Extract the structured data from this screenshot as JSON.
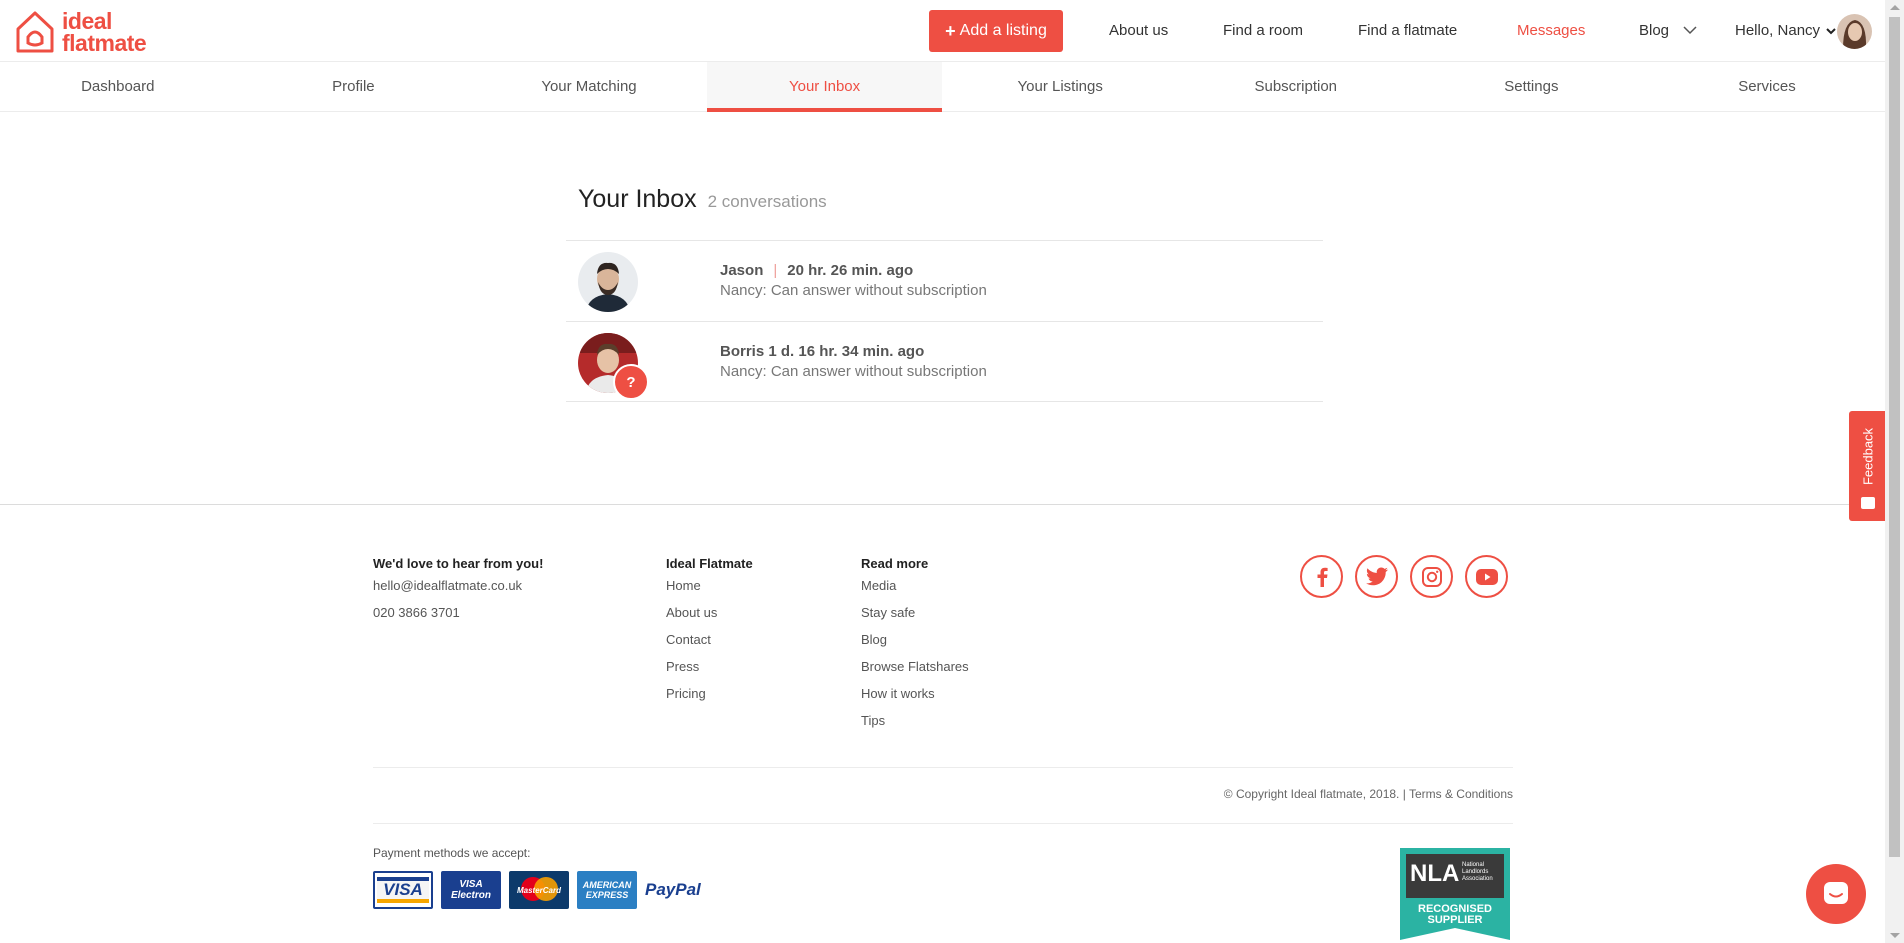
{
  "brand": {
    "line1": "ideal",
    "line2": "flatmate",
    "color": "#ee4f43"
  },
  "topnav": {
    "add_listing": "Add a listing",
    "about": "About us",
    "find_room": "Find a room",
    "find_flatmate": "Find a flatmate",
    "messages": "Messages",
    "blog": "Blog",
    "user": "Hello, Nancy"
  },
  "subnav": [
    "Dashboard",
    "Profile",
    "Your Matching",
    "Your Inbox",
    "Your Listings",
    "Subscription",
    "Settings",
    "Services"
  ],
  "inbox": {
    "title": "Your Inbox",
    "count": "2 conversations",
    "conversations": [
      {
        "name": "Jason",
        "time": "20 hr. 26 min. ago",
        "message": "Nancy: Can answer without subscription"
      },
      {
        "name": "Borris",
        "time": "1 d. 16 hr. 34 min. ago",
        "message": "Nancy: Can answer without subscription",
        "badge": "?"
      }
    ]
  },
  "footer": {
    "contact": {
      "heading": "We'd love to hear from you!",
      "email": "hello@idealflatmate.co.uk",
      "phone": "020 3866 3701"
    },
    "ideal": {
      "heading": "Ideal Flatmate",
      "links": [
        "Home",
        "About us",
        "Contact",
        "Press",
        "Pricing"
      ]
    },
    "read_more": {
      "heading": "Read more",
      "links": [
        "Media",
        "Stay safe",
        "Blog",
        "Browse Flatshares",
        "How it works",
        "Tips"
      ]
    },
    "copyright": "© Copyright Ideal flatmate, 2018. | Terms & Conditions",
    "payment_label": "Payment methods we accept:",
    "cards": [
      "VISA",
      "VISA Electron",
      "MasterCard",
      "AMERICAN EXPRESS",
      "PayPal"
    ],
    "nla": {
      "name": "NLA",
      "sub": "National Landlords Association",
      "badge1": "RECOGNISED",
      "badge2": "SUPPLIER"
    }
  },
  "feedback": "Feedback"
}
